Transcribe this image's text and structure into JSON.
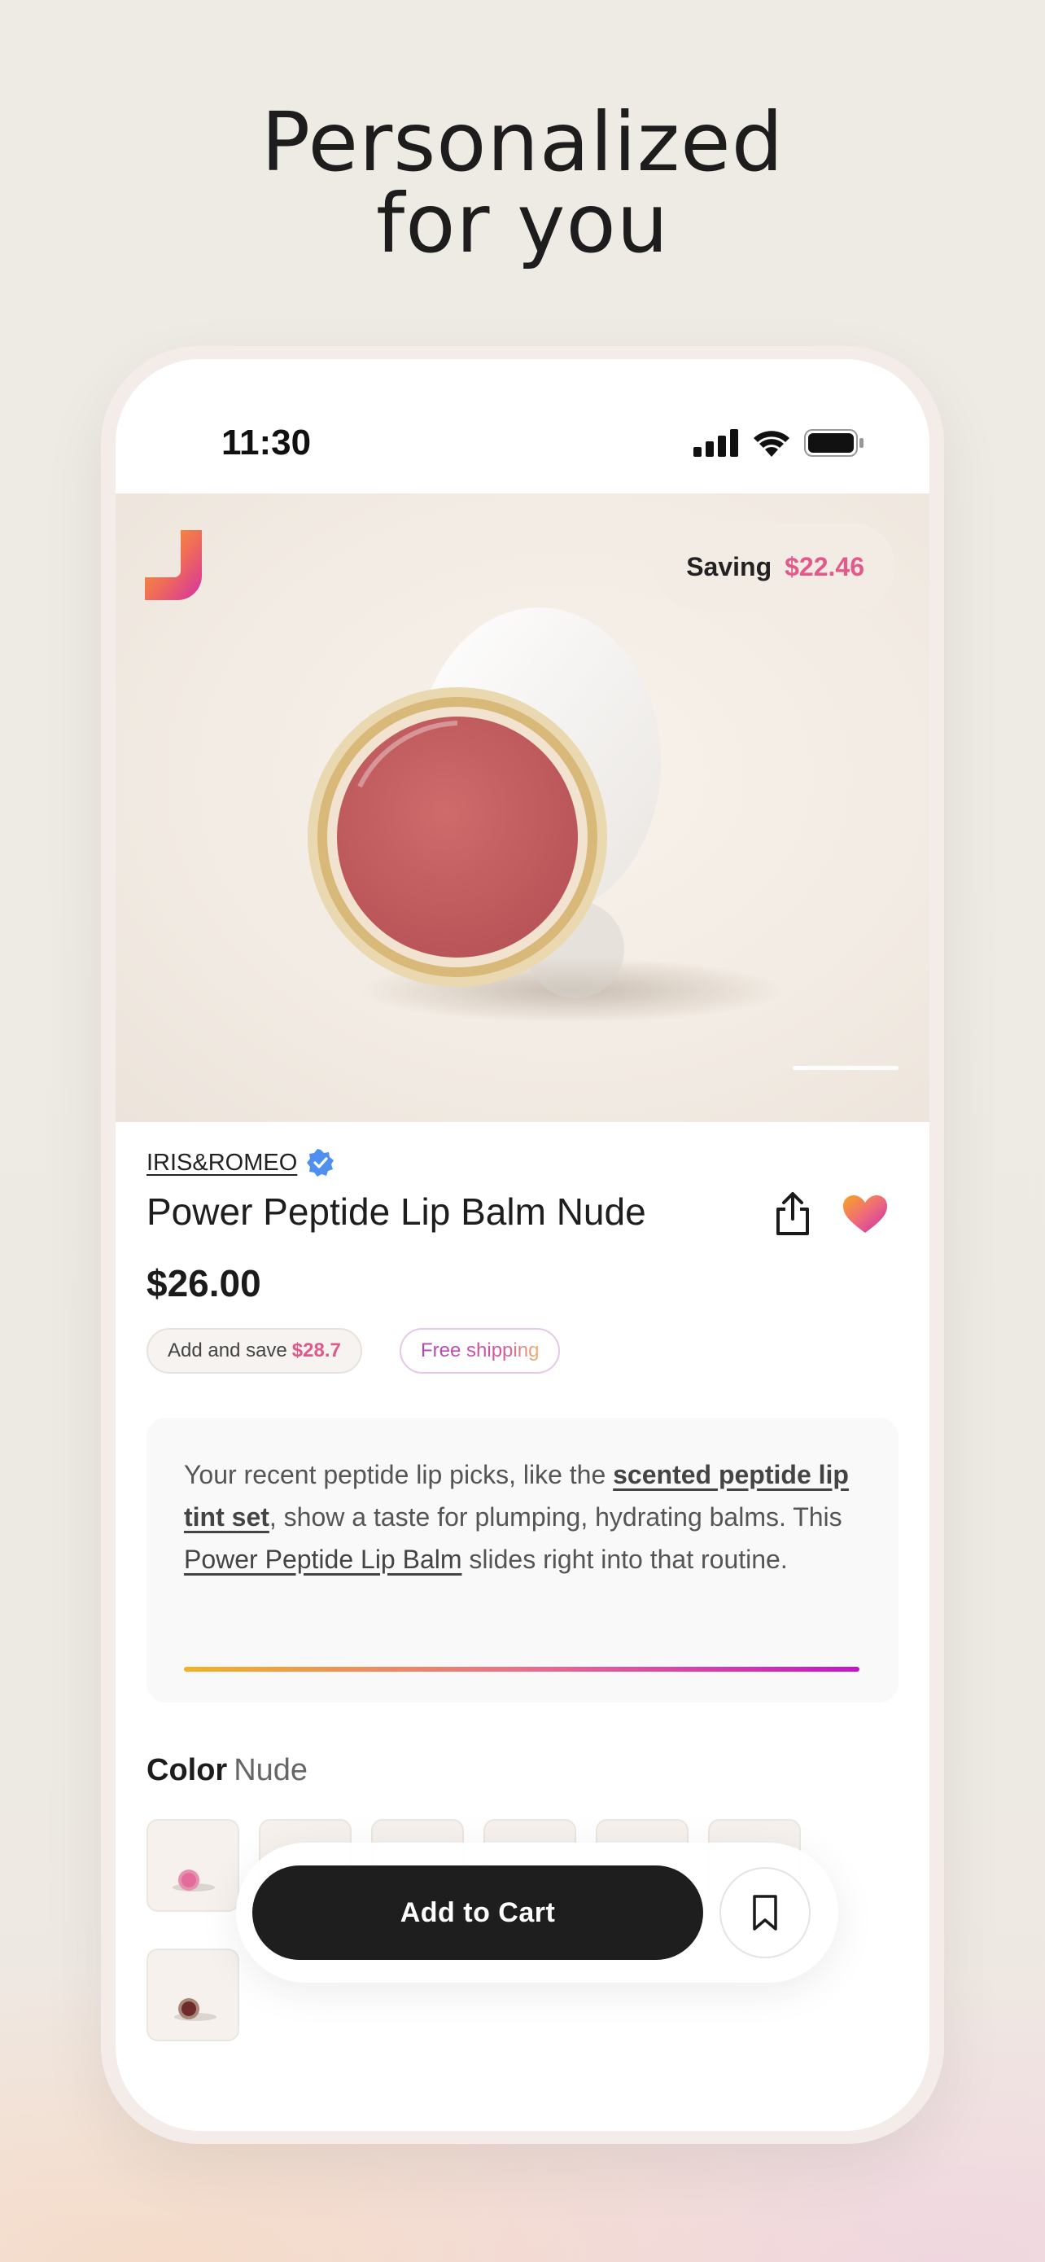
{
  "headline": {
    "line1": "Personalized",
    "line2": "for you"
  },
  "status_bar": {
    "time": "11:30"
  },
  "hero": {
    "saving_label": "Saving",
    "saving_amount": "$22.46"
  },
  "product": {
    "brand": "IRIS&ROMEO",
    "title": "Power Peptide Lip Balm Nude",
    "price": "$26.00",
    "chips": {
      "add_and_save_label": "Add and save",
      "add_and_save_amount": "$28.7",
      "free_shipping": "Free shipping"
    }
  },
  "recommendation": {
    "text_1": "Your recent peptide lip picks, like the ",
    "link_1": "scented peptide lip tint set",
    "text_2": ", show a taste for plumping, hydrating balms. This ",
    "link_2": "Power Peptide Lip Balm",
    "text_3": " slides right into that routine."
  },
  "color": {
    "label": "Color",
    "selected": "Nude"
  },
  "actions": {
    "add_to_cart": "Add to Cart"
  },
  "colors": {
    "accent_pink": "#e35a8a",
    "gradient_start": "#f2b225",
    "gradient_end": "#c216c9",
    "button_dark": "#1e1e1e"
  },
  "icons": [
    "signal-icon",
    "wifi-icon",
    "battery-icon",
    "share-icon",
    "heart-icon",
    "verified-icon",
    "bookmark-icon",
    "brand-logo"
  ]
}
